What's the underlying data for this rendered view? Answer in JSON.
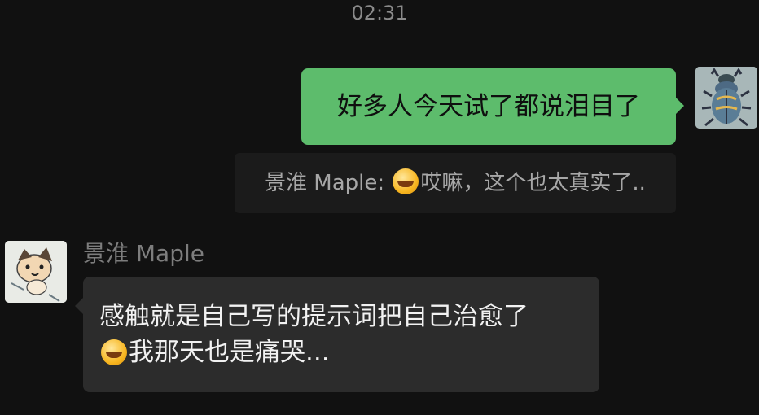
{
  "timestamp": "02:31",
  "outgoing_message": {
    "text": "好多人今天试了都说泪目了",
    "avatar_icon": "beetle-icon"
  },
  "quoted_message": {
    "sender": "景淮 Maple:",
    "emoji": "crying-face-emoji",
    "text": "哎嘛，这个也太真实了.."
  },
  "incoming_message": {
    "sender": "景淮 Maple",
    "avatar_icon": "cartoon-dog-icon",
    "line1": "感触就是自己写的提示词把自己治愈了",
    "emoji": "crying-face-emoji",
    "line2": "我那天也是痛哭..."
  },
  "colors": {
    "background": "#111111",
    "outgoing_bubble": "#5dbc6c",
    "incoming_bubble": "#2c2c2c",
    "quote_bubble": "#1b1b1b"
  }
}
